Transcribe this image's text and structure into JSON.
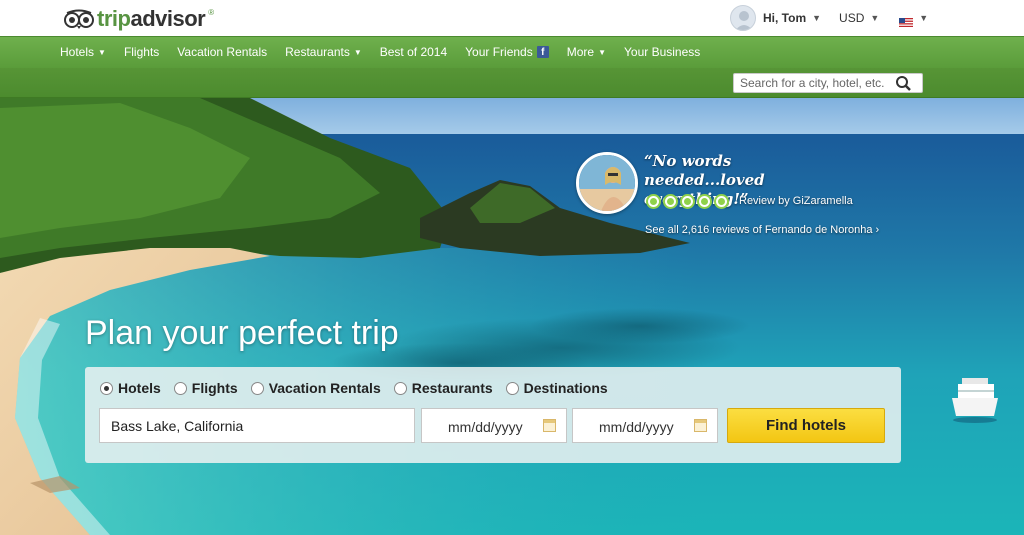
{
  "brand": {
    "logo_text_trip": "trip",
    "logo_text_advisor": "advisor",
    "logo_reg": "®"
  },
  "user": {
    "greeting": "Hi, Tom",
    "currency": "USD"
  },
  "nav": {
    "items": [
      {
        "label": "Hotels",
        "caret": true
      },
      {
        "label": "Flights",
        "caret": false
      },
      {
        "label": "Vacation Rentals",
        "caret": false
      },
      {
        "label": "Restaurants",
        "caret": true
      },
      {
        "label": "Best of 2014",
        "caret": false
      },
      {
        "label": "Your Friends",
        "caret": false,
        "facebook": true
      },
      {
        "label": "More",
        "caret": true
      },
      {
        "label": "Your Business",
        "caret": false
      }
    ]
  },
  "search": {
    "placeholder": "Search for a city, hotel, etc."
  },
  "hero": {
    "quote": "“No words needed...loved everything!”",
    "rating_bubbles": 5,
    "review_by": "Review by GiZaramella",
    "see_all": "See all 2,616 reviews of Fernando de Noronha  ›",
    "title": "Plan your perfect trip"
  },
  "planner": {
    "tabs": [
      {
        "label": "Hotels",
        "selected": true
      },
      {
        "label": "Flights",
        "selected": false
      },
      {
        "label": "Vacation Rentals",
        "selected": false
      },
      {
        "label": "Restaurants",
        "selected": false
      },
      {
        "label": "Destinations",
        "selected": false
      }
    ],
    "destination_value": "Bass Lake, California",
    "checkin_placeholder": "mm/dd/yyyy",
    "checkout_placeholder": "mm/dd/yyyy",
    "find_button": "Find hotels"
  },
  "colors": {
    "brand_green": "#589442",
    "nav_green": "#5a9c3a",
    "button_yellow": "#f3c613"
  }
}
